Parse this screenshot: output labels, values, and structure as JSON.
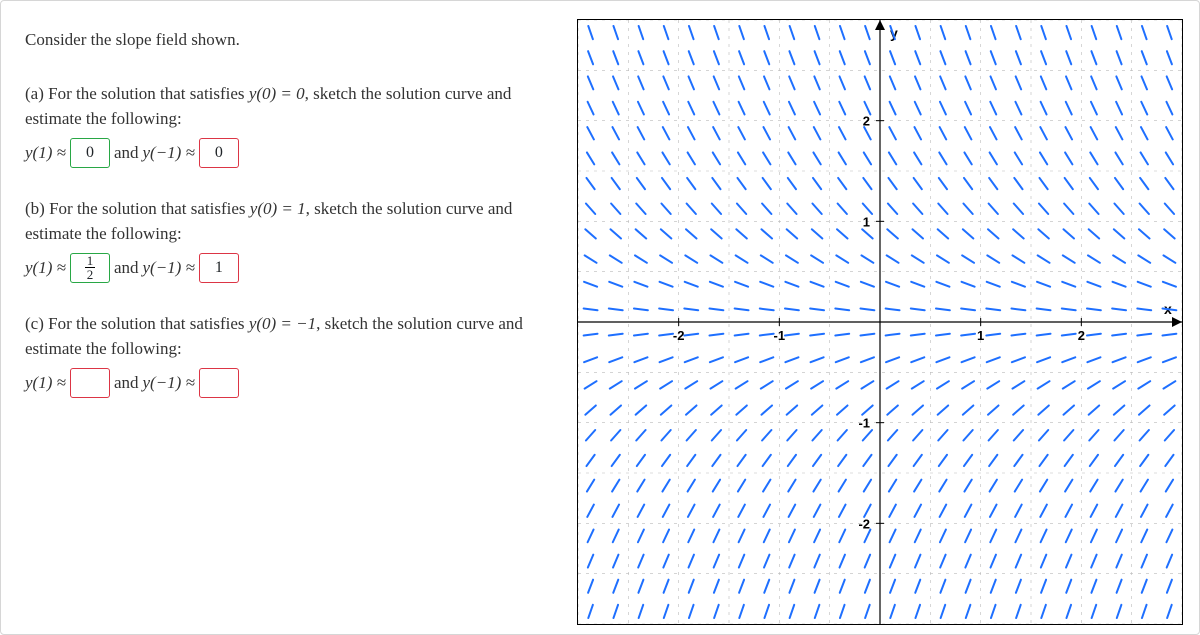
{
  "intro": "Consider the slope field shown.",
  "parts": {
    "a": {
      "prompt": "(a) For the solution that satisfies ",
      "cond_pre": "y(0) = 0",
      "prompt_tail": ", sketch the solution curve and estimate the following:",
      "lhs1": "y(1) ≈",
      "ans1": "0",
      "ans1_state": "correct",
      "mid": " and ",
      "lhs2": "y(−1) ≈",
      "ans2": "0",
      "ans2_state": "wrong"
    },
    "b": {
      "prompt": "(b) For the solution that satisfies ",
      "cond_pre": "y(0) = 1",
      "prompt_tail": ", sketch the solution curve and estimate the following:",
      "lhs1": "y(1) ≈",
      "ans1_num": "1",
      "ans1_den": "2",
      "ans1_state": "correct",
      "mid": " and ",
      "lhs2": "y(−1) ≈",
      "ans2": "1",
      "ans2_state": "wrong"
    },
    "c": {
      "prompt": "(c) For the solution that satisfies ",
      "cond_pre": "y(0) = −1",
      "prompt_tail": ", sketch the solution curve and estimate the following:",
      "lhs1": "y(1) ≈",
      "ans1": "",
      "ans1_state": "wrong",
      "mid": " and ",
      "lhs2": "y(−1) ≈",
      "ans2": "",
      "ans2_state": "wrong"
    }
  },
  "chart_data": {
    "type": "vector-field",
    "title": "",
    "xlabel": "x",
    "ylabel": "y",
    "xlim": [
      -3,
      3
    ],
    "ylim": [
      -3,
      3
    ],
    "xticks": [
      -2,
      -1,
      1,
      2
    ],
    "yticks": [
      -2,
      -1,
      1,
      2
    ],
    "grid": true,
    "slope_function": "dy/dx = -y",
    "description": "Slope segments negative for y>0, zero at y=0, positive for y<0; magnitude increases with |y|.",
    "step": 0.25
  }
}
